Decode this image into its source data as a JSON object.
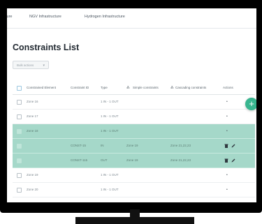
{
  "nav": {
    "items": [
      "ture",
      "NGV Infrastructure",
      "Hydrogen Infrastructure"
    ]
  },
  "page": {
    "title": "Constraints List",
    "bulk_actions_label": "Bulk actions"
  },
  "table": {
    "columns": [
      "Constrained Element",
      "Constraint ID",
      "Type",
      "Simple constraints",
      "Cascading constraints",
      "Actions"
    ],
    "column_icons": {
      "simple": "⁂",
      "cascading": "⁂"
    },
    "rows": [
      {
        "element": "Zone 16",
        "id": "",
        "type": "1 IN - 1 OUT",
        "simple": "",
        "cascading": "",
        "highlight": false,
        "actions": "dot"
      },
      {
        "element": "Zone 17",
        "id": "",
        "type": "1 IN - 1 OUT",
        "simple": "",
        "cascading": "",
        "highlight": false,
        "actions": "dot"
      },
      {
        "element": "Zone 18",
        "id": "",
        "type": "1 IN - 1 OUT",
        "simple": "",
        "cascading": "",
        "highlight": true,
        "actions": "dot"
      },
      {
        "element": "",
        "id": "CONST-15",
        "type": "IN",
        "simple": "Zone 19",
        "cascading": "Zone 21,22,23",
        "highlight": true,
        "actions": "edit"
      },
      {
        "element": "",
        "id": "CONST-115",
        "type": "OUT",
        "simple": "Zone 19",
        "cascading": "Zone 21,22,23",
        "highlight": true,
        "actions": "edit"
      },
      {
        "element": "Zone 19",
        "id": "",
        "type": "1 IN - 1 OUT",
        "simple": "",
        "cascading": "",
        "highlight": false,
        "actions": "dot"
      },
      {
        "element": "Zone 20",
        "id": "",
        "type": "1 IN - 1 OUT",
        "simple": "",
        "cascading": "",
        "highlight": false,
        "actions": "dot"
      }
    ]
  },
  "icons": {
    "fab": "plus-icon",
    "edit": "pencil-icon",
    "delete": "trash-icon",
    "more": "dot-icon"
  },
  "fab_label": "+",
  "colors": {
    "accent": "#38b58f",
    "highlight_row": "#a5d8c9",
    "title": "#222a32"
  }
}
